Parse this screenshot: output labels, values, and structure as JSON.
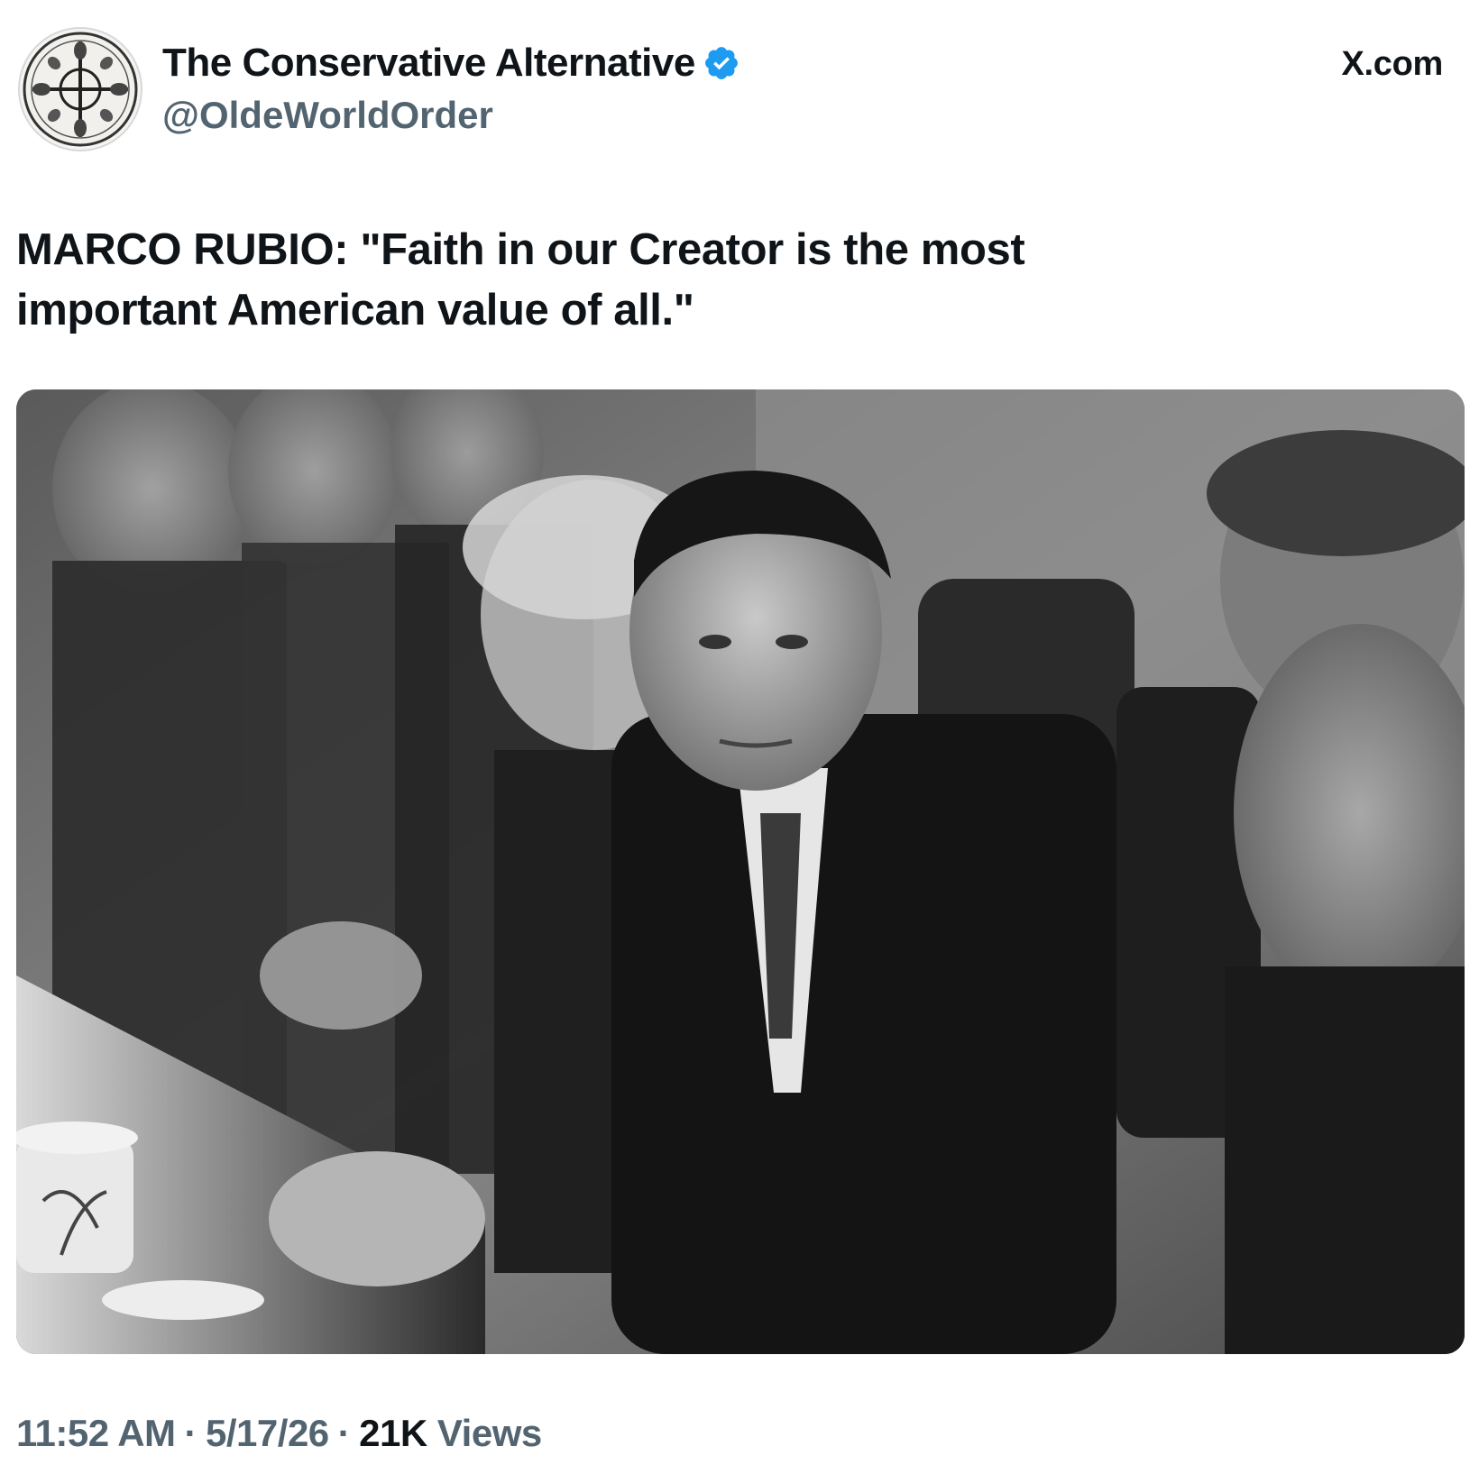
{
  "tweet": {
    "author": {
      "display_name": "The Conservative Alternative",
      "handle": "@OldeWorldOrder",
      "verified": true,
      "verified_color": "#1d9bf0"
    },
    "source": "X.com",
    "text_line1": "MARCO RUBIO: \"Faith in our Creator is the most",
    "text_line2": "important American value of all.\"",
    "media": {
      "type": "photo",
      "style": "black-and-white"
    },
    "meta": {
      "time": "11:52 AM",
      "separator": "·",
      "date": "5/17/26",
      "views_count": "21K",
      "views_label": "Views"
    }
  },
  "colors": {
    "text_primary": "#0f1419",
    "text_secondary": "#536471",
    "background": "#ffffff"
  }
}
